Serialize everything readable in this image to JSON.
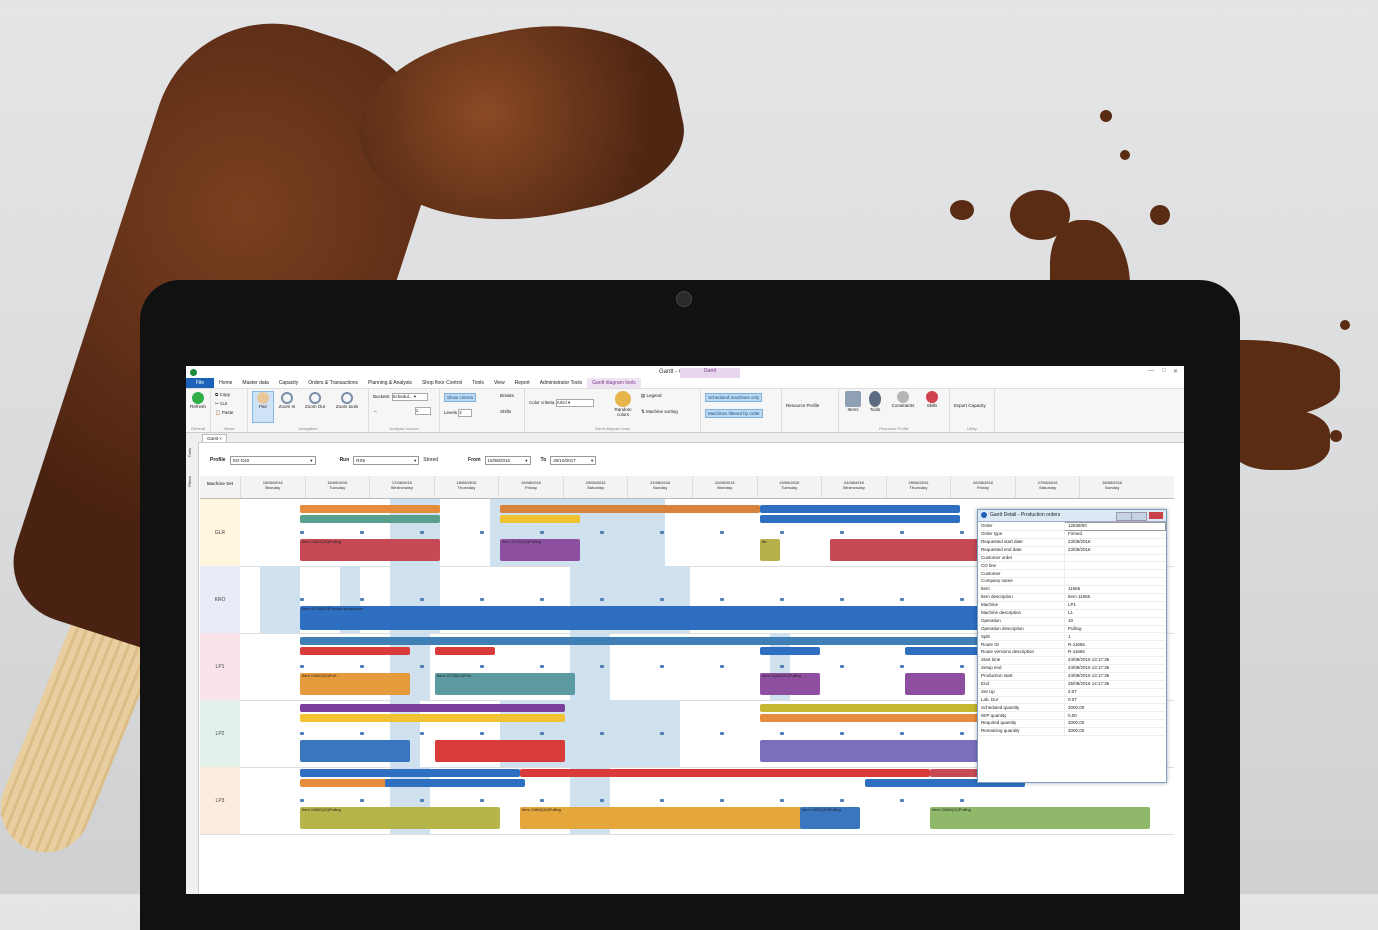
{
  "window": {
    "title": "Gantt - Compass10",
    "context_tab": "Gantt"
  },
  "menu": [
    "File",
    "Home",
    "Master data",
    "Capacity",
    "Orders & Transactions",
    "Planning & Analysis",
    "Shop floor Control",
    "Tools",
    "View",
    "Report",
    "Administrator Tools",
    "Gantt diagram tools"
  ],
  "ribbon": {
    "general": {
      "refresh": "Refresh",
      "label": "General"
    },
    "clipboard": {
      "copy": "Copy",
      "cut": "Cut",
      "paste": "Paste",
      "label": "Views"
    },
    "navigation": {
      "pan": "Pan",
      "zoom_in": "Zoom In",
      "zoom_out": "Zoom Out",
      "zoom_tools": "Zoom tools",
      "label": "Navigation"
    },
    "analysis": {
      "buckets_label": "Buckets",
      "buckets_value": "Schedul...",
      "step_value": "1",
      "label": "Analysis horizon"
    },
    "show": {
      "show_criteria": "Show criteria",
      "breaks": "Breaks",
      "shifts": "Shifts",
      "levels_label": "Levels",
      "levels_value": "2"
    },
    "diagram": {
      "color_label": "Color criteria",
      "color_value": "Articl",
      "random_colors": "Random colors",
      "legend": "Legend",
      "machine_sorting": "Machine sorting",
      "label": "Gantt diagram tools"
    },
    "schedule": {
      "scheduled_only": "Scheduled machines only",
      "filtered": "Machines filtered by order"
    },
    "resource": {
      "resource_profile": "Resource Profile",
      "items": "Items",
      "tools": "Tools",
      "constraints": "Constraints",
      "skills": "Skills",
      "label": "Resource Profile"
    },
    "utility": {
      "export_capacity": "Export Capacity",
      "label": "Utility"
    }
  },
  "doc_tab": "Gantt",
  "side_tabs": [
    "Tools",
    "Filters"
  ],
  "filters": {
    "profile_label": "Profile",
    "profile_value": "SO-G40",
    "run_label": "Run",
    "run_value": "RS9",
    "stored": "Stored",
    "from_label": "From",
    "from_value": "15/08/2016",
    "to_label": "To",
    "to_value": "30/10/2017"
  },
  "gantt": {
    "machine_header": "Machine Set",
    "days": [
      {
        "date": "15/08/2016",
        "day": "Monday"
      },
      {
        "date": "16/08/2016",
        "day": "Tuesday"
      },
      {
        "date": "17/08/2016",
        "day": "Wednesday"
      },
      {
        "date": "18/08/2016",
        "day": "Thursday"
      },
      {
        "date": "19/08/2016",
        "day": "Friday"
      },
      {
        "date": "20/08/2016",
        "day": "Saturday"
      },
      {
        "date": "21/08/2016",
        "day": "Sunday"
      },
      {
        "date": "22/08/2016",
        "day": "Monday"
      },
      {
        "date": "23/08/2016",
        "day": "Tuesday"
      },
      {
        "date": "24/08/2016",
        "day": "Wednesday"
      },
      {
        "date": "25/08/2016",
        "day": "Thursday"
      },
      {
        "date": "26/08/2016",
        "day": "Friday"
      },
      {
        "date": "27/08/2016",
        "day": "Saturday"
      },
      {
        "date": "28/08/2016",
        "day": "Sunday"
      }
    ],
    "rows": [
      "GLR",
      "KRO",
      "LP1",
      "LP2",
      "LP3"
    ]
  },
  "detail": {
    "title": "Gantt Detail - Production orders",
    "fields": [
      [
        "Order",
        "12539/00"
      ],
      [
        "Order type",
        "Firmed"
      ],
      [
        "Requested start date",
        "23/08/2016"
      ],
      [
        "Requested end date",
        "23/08/2016"
      ],
      [
        "Customer order",
        ""
      ],
      [
        "CO line",
        ""
      ],
      [
        "Customer",
        ""
      ],
      [
        "Company name",
        ""
      ],
      [
        "Item",
        "11656"
      ],
      [
        "Item description",
        "Item 11656"
      ],
      [
        "Machine",
        "LP1"
      ],
      [
        "Machine description",
        "L1"
      ],
      [
        "Operation",
        "10"
      ],
      [
        "Operation description",
        "Pulling"
      ],
      [
        "Split",
        "1"
      ],
      [
        "Route ID",
        "R-11656"
      ],
      [
        "Route versions description",
        "R-11656"
      ],
      [
        "Start time",
        "24/08/2016 13:17:36"
      ],
      [
        "Setup end",
        "24/08/2016 13:17:36"
      ],
      [
        "Production start",
        "24/08/2016 13:17:36"
      ],
      [
        "End",
        "25/08/2016 14:17:36"
      ],
      [
        "Set Up",
        "2:07"
      ],
      [
        "Lab. Dur",
        "0:07"
      ],
      [
        "Scheduled quantity",
        "2000,00"
      ],
      [
        "WIP quantity",
        "0,00"
      ],
      [
        "Required quantity",
        "2000,00"
      ],
      [
        "Remaining quantity",
        "2000,00"
      ]
    ]
  },
  "bar_labels": {
    "glr_1": "Item 11651(10)Pulling",
    "glr_2": "Item 11602(10)Pul...",
    "glr_3": "Item 12701(10)Pulling",
    "glr_4": "Ite...",
    "kro_1": "Item 12705(10)Product production",
    "lp1_1": "Item 11...",
    "lp1_2": "Item 11650(10)Pull...",
    "lp1_3": "Item 11650(10)Pull...",
    "lp1_4": "Item 12700(10)Pull...",
    "lp1_5": "Item 12702(10)Pulling",
    "lp1_6": "Item 11655(10)Pulling",
    "lp1_7": "Item 11656(10)Pulling",
    "lp3_1": "Item 11650(10)Pulling",
    "lp3_2": "Item 11666(10)Pulling",
    "lp3_3": "Item 11652(10)Pulling",
    "lp3_4": "Item 11694(10)Pulling",
    "lp3_5": "Item 11666(10)Pulling"
  },
  "colors": {
    "accent": "#1c62b8",
    "context": "#7a3b8a",
    "chocolate": "#4f2612"
  }
}
